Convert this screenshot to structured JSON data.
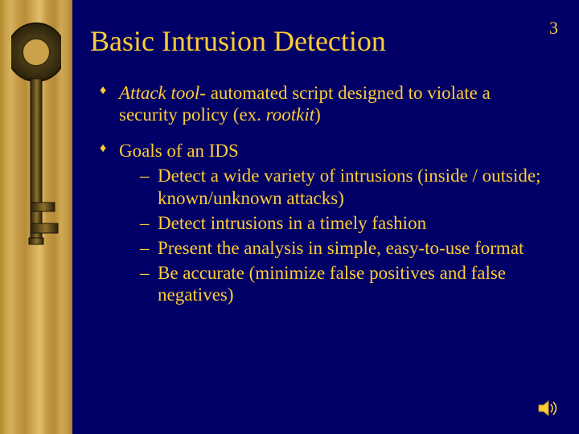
{
  "page_number": "3",
  "title": "Basic Intrusion Detection",
  "bullets": [
    {
      "lead_italic": "Attack tool",
      "rest": "- automated script designed to violate a security policy (ex. ",
      "tail_italic": "rootkit",
      "tail_rest": ")"
    },
    {
      "text": "Goals of an IDS",
      "sub": [
        "Detect a wide variety of intrusions (inside / outside; known/unknown attacks)",
        "Detect intrusions in a timely fashion",
        "Present the analysis in simple, easy-to-use format",
        "Be accurate (minimize false positives and false negatives)"
      ]
    }
  ],
  "icons": {
    "sound": "sound-icon"
  }
}
